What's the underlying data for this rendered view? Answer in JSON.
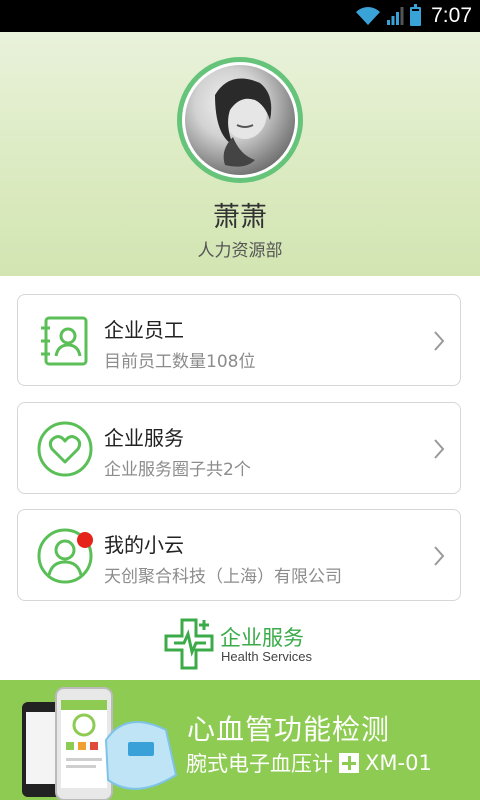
{
  "status_bar": {
    "time": "7:07"
  },
  "profile": {
    "name": "萧萧",
    "department": "人力资源部"
  },
  "cards": [
    {
      "title": "企业员工",
      "subtitle": "目前员工数量108位",
      "icon": "employee-contacts-icon"
    },
    {
      "title": "企业服务",
      "subtitle": "企业服务圈子共2个",
      "icon": "heart-icon"
    },
    {
      "title": "我的小云",
      "subtitle": "天创聚合科技（上海）有限公司",
      "icon": "user-profile-icon",
      "notification_dot": true
    }
  ],
  "logo": {
    "title": "企业服务",
    "subtitle": "Health Services"
  },
  "banner": {
    "title": "心血管功能检测",
    "subtitle_prefix": "腕式电子血压计",
    "subtitle_model": "XM-01"
  },
  "colors": {
    "accent_green": "#3bab4a",
    "banner_green": "#8dcb52",
    "notification_red": "#e5231b"
  }
}
